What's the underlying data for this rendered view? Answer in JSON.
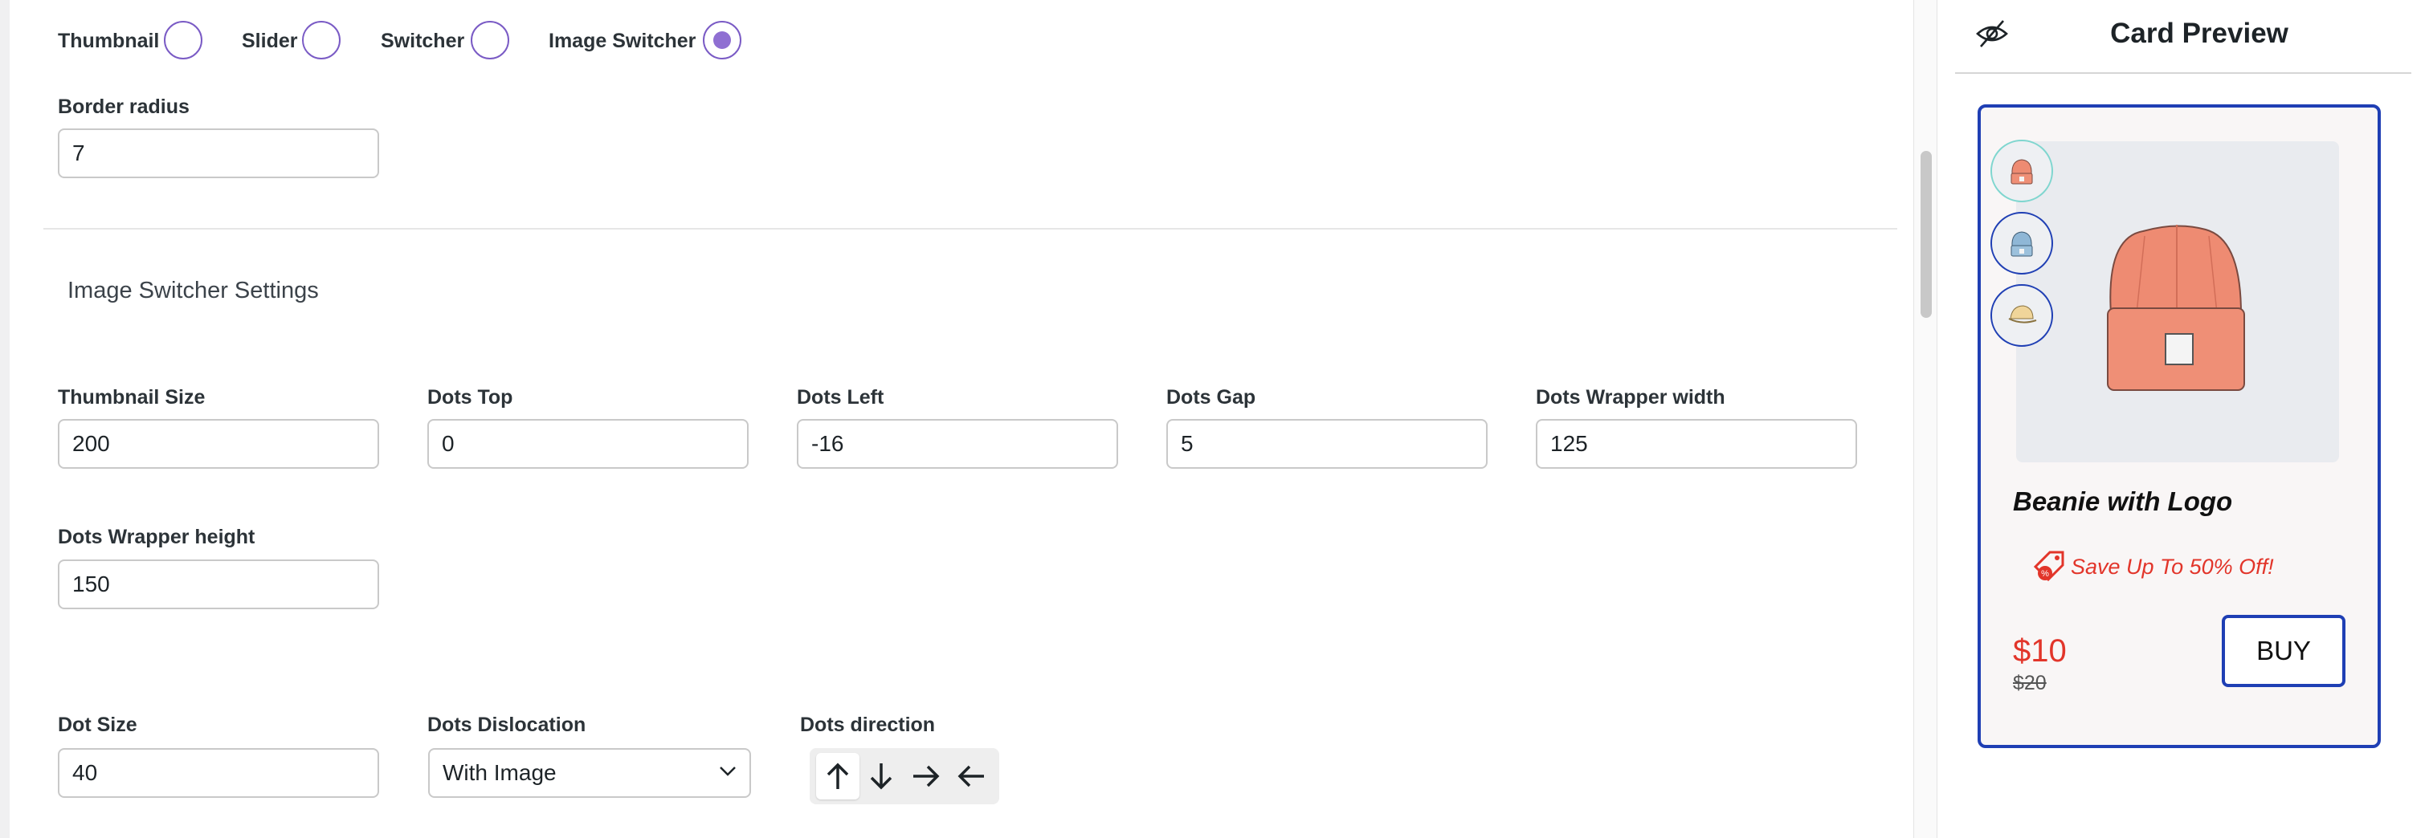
{
  "style_options": [
    {
      "label": "Thumbnail",
      "selected": false
    },
    {
      "label": "Slider",
      "selected": false
    },
    {
      "label": "Switcher",
      "selected": false
    },
    {
      "label": "Image Switcher",
      "selected": true
    }
  ],
  "border_radius": {
    "label": "Border radius",
    "value": "7"
  },
  "section_title": "Image Switcher Settings",
  "fields": {
    "thumbnail_size": {
      "label": "Thumbnail Size",
      "value": "200"
    },
    "dots_top": {
      "label": "Dots Top",
      "value": "0"
    },
    "dots_left": {
      "label": "Dots Left",
      "value": "-16"
    },
    "dots_gap": {
      "label": "Dots Gap",
      "value": "5"
    },
    "dots_wrapper_width": {
      "label": "Dots Wrapper width",
      "value": "125"
    },
    "dots_wrapper_height": {
      "label": "Dots Wrapper height",
      "value": "150"
    },
    "dot_size": {
      "label": "Dot Size",
      "value": "40"
    },
    "dots_dislocation": {
      "label": "Dots Dislocation",
      "value": "With Image"
    },
    "dots_direction": {
      "label": "Dots direction",
      "options": [
        "up",
        "down",
        "right",
        "left"
      ],
      "selected": "up"
    }
  },
  "preview": {
    "title": "Card Preview",
    "product_name": "Beanie with Logo",
    "promo": "Save Up To 50% Off!",
    "price": "$10",
    "old_price": "$20",
    "buy_label": "BUY",
    "colors": {
      "accent": "#1f3fb4",
      "sale": "#e2352a",
      "radio": "#8f6fd2"
    }
  }
}
